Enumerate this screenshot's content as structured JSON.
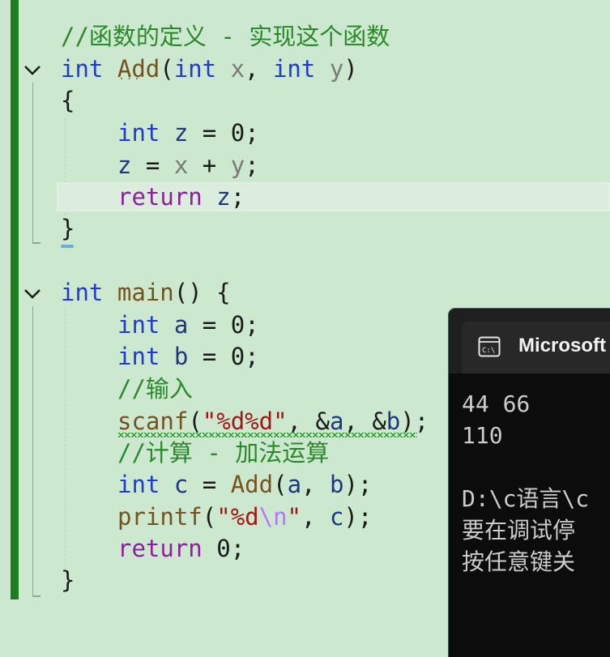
{
  "editor": {
    "comment1": "//函数的定义 - 实现这个函数",
    "kw_int": "int",
    "add_name": "Add",
    "param_x": "x",
    "param_y": "y",
    "var_z": "z",
    "assign_zero": "0",
    "kw_return": "return",
    "main_name": "main",
    "var_a": "a",
    "var_b": "b",
    "var_c": "c",
    "comment_input": "//输入",
    "scanf_name": "scanf",
    "scanf_fmt": "\"%d%d\"",
    "comment_calc": "//计算 - 加法运算",
    "printf_name": "printf",
    "printf_fmt_a": "\"%d",
    "printf_fmt_esc": "\\n",
    "printf_fmt_b": "\"",
    "open_brace": "{",
    "close_brace": "}"
  },
  "console": {
    "title": "Microsoft",
    "lines": [
      "44 66",
      "110",
      "",
      "D:\\c语言\\c",
      "要在调试停",
      "按任意键关"
    ]
  }
}
